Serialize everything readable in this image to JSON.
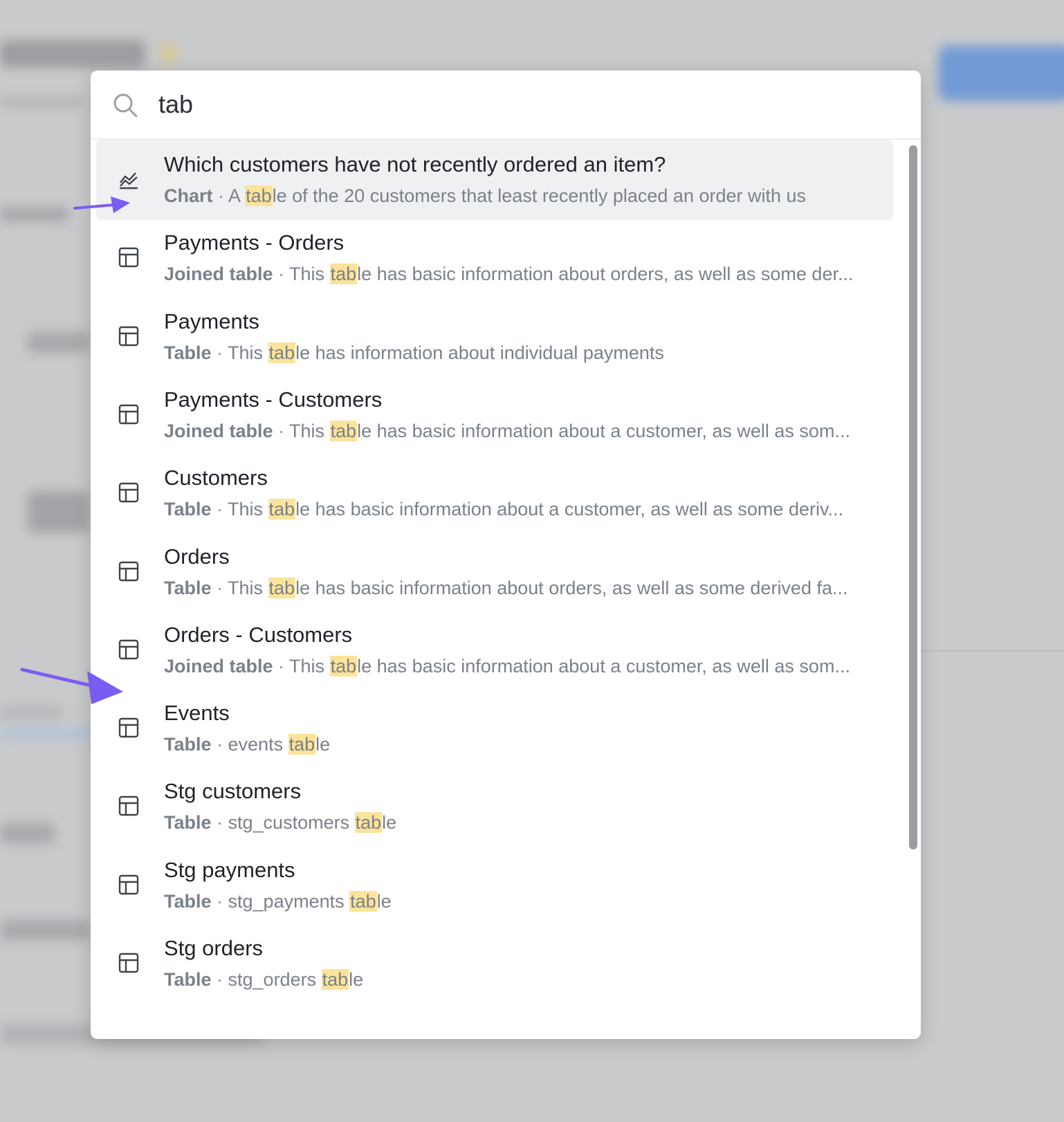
{
  "search": {
    "value": "tab",
    "placeholder": ""
  },
  "results": [
    {
      "icon": "chart-icon",
      "title_parts": [
        "Which customers have not recently ordered an item?"
      ],
      "type": "Chart",
      "desc_before": "A ",
      "desc_match": "tab",
      "desc_after": "le of the 20 customers that least recently placed an order with us",
      "active": true
    },
    {
      "icon": "table-icon",
      "title_parts": [
        "Payments",
        " - ",
        "Orders"
      ],
      "type": "Joined table",
      "desc_before": "This ",
      "desc_match": "tab",
      "desc_after": "le has basic information about orders, as well as some der..."
    },
    {
      "icon": "table-icon",
      "title_parts": [
        "Payments"
      ],
      "type": "Table",
      "desc_before": "This ",
      "desc_match": "tab",
      "desc_after": "le has information about individual payments"
    },
    {
      "icon": "table-icon",
      "title_parts": [
        "Payments",
        " - ",
        "Customers"
      ],
      "type": "Joined table",
      "desc_before": "This ",
      "desc_match": "tab",
      "desc_after": "le has basic information about a customer, as well as som..."
    },
    {
      "icon": "table-icon",
      "title_parts": [
        "Customers"
      ],
      "type": "Table",
      "desc_before": "This ",
      "desc_match": "tab",
      "desc_after": "le has basic information about a customer, as well as some deriv..."
    },
    {
      "icon": "table-icon",
      "title_parts": [
        "Orders"
      ],
      "type": "Table",
      "desc_before": "This ",
      "desc_match": "tab",
      "desc_after": "le has basic information about orders, as well as some derived fa..."
    },
    {
      "icon": "table-icon",
      "title_parts": [
        "Orders",
        " - ",
        "Customers"
      ],
      "type": "Joined table",
      "desc_before": "This ",
      "desc_match": "tab",
      "desc_after": "le has basic information about a customer, as well as som..."
    },
    {
      "icon": "table-icon",
      "title_parts": [
        "Events"
      ],
      "type": "Table",
      "desc_before": "events ",
      "desc_match": "tab",
      "desc_after": "le"
    },
    {
      "icon": "table-icon",
      "title_parts": [
        "Stg customers"
      ],
      "type": "Table",
      "desc_before": "stg_customers ",
      "desc_match": "tab",
      "desc_after": "le"
    },
    {
      "icon": "table-icon",
      "title_parts": [
        "Stg payments"
      ],
      "type": "Table",
      "desc_before": "stg_payments ",
      "desc_match": "tab",
      "desc_after": "le"
    },
    {
      "icon": "table-icon",
      "title_parts": [
        "Stg orders"
      ],
      "type": "Table",
      "desc_before": "stg_orders ",
      "desc_match": "tab",
      "desc_after": "le"
    }
  ],
  "separator": " · ",
  "colors": {
    "highlight": "#fbe39a",
    "active_row": "#eff0f2",
    "annotation_arrow": "#7b5cf0"
  }
}
